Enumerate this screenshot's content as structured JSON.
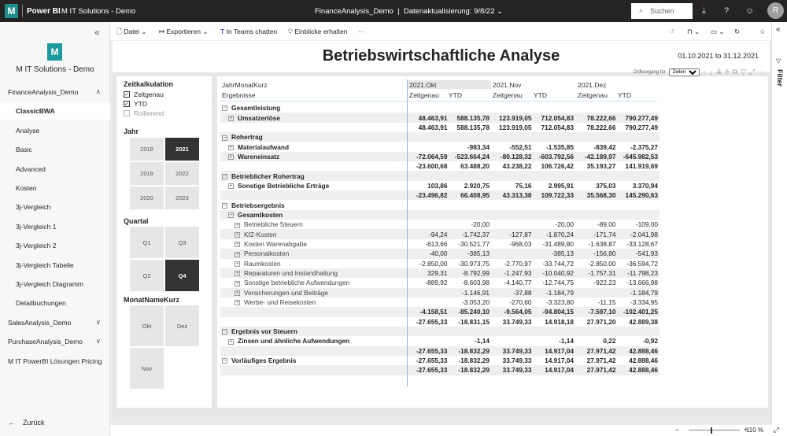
{
  "topbar": {
    "logo": "M",
    "app": "Power BI",
    "workspace": "M IT Solutions - Demo",
    "report": "FinanceAnalysis_Demo",
    "refresh": "Datenaktualisierung: 9/8/22",
    "search_placeholder": "Suchen",
    "avatar_initial": "R"
  },
  "toolbar": {
    "file": "Datei",
    "export": "Exportieren",
    "teams": "In Teams chatten",
    "insights": "Einblicke erhalten",
    "more": "···"
  },
  "sidebar": {
    "logo": "M",
    "workspace": "M IT Solutions - Demo",
    "items": [
      {
        "label": "FinanceAnalysis_Demo",
        "chev": "∧"
      },
      {
        "label": "ClassicBWA",
        "sub": true,
        "selected": true
      },
      {
        "label": "Analyse",
        "sub": true
      },
      {
        "label": "Basic",
        "sub": true
      },
      {
        "label": "Advanced",
        "sub": true
      },
      {
        "label": "Kosten",
        "sub": true
      },
      {
        "label": "3j-Vergleich",
        "sub": true
      },
      {
        "label": "3j-Vergleich 1",
        "sub": true
      },
      {
        "label": "3j-Vergleich 2",
        "sub": true
      },
      {
        "label": "3j-Vergleich Tabelle",
        "sub": true
      },
      {
        "label": "3j-Vergleich Diagramm",
        "sub": true
      },
      {
        "label": "Detailbuchungen",
        "sub": true
      },
      {
        "label": "SalesAnalysis_Demo",
        "chev": "∨"
      },
      {
        "label": "PurchaseAnalysis_Demo",
        "chev": "∨"
      },
      {
        "label": "M IT PowerBI Lösungen Pricing"
      }
    ],
    "back": "Zurück"
  },
  "report": {
    "title": "Betriebswirtschaftliche Analyse",
    "daterange": "01.10.2021 to 31.12.2021",
    "drill_label": "Drillvorgang für",
    "drill_value": "Zeilen"
  },
  "slicers": {
    "zeit": {
      "title": "Zeitkalkulation",
      "options": [
        {
          "label": "Zeitgenau",
          "checked": true
        },
        {
          "label": "YTD",
          "checked": true
        },
        {
          "label": "Rollierend",
          "checked": false
        }
      ]
    },
    "jahr": {
      "title": "Jahr",
      "tiles": [
        {
          "label": "2018"
        },
        {
          "label": "2021",
          "selected": true
        },
        {
          "label": "2019"
        },
        {
          "label": "2022"
        },
        {
          "label": "2020"
        },
        {
          "label": "2023"
        }
      ]
    },
    "quartal": {
      "title": "Quartal",
      "tiles": [
        {
          "label": "Q1"
        },
        {
          "label": "Q3"
        },
        {
          "label": "Q2"
        },
        {
          "label": "Q4",
          "selected": true
        }
      ]
    },
    "monat": {
      "title": "MonatNameKurz",
      "tiles": [
        {
          "label": "Okt"
        },
        {
          "label": "Dez"
        },
        {
          "label": "Nov"
        }
      ]
    }
  },
  "matrix": {
    "row_header1": "JahrMonatKurz",
    "row_header2": "Ergebnisse",
    "months": [
      "2021.Okt",
      "2021.Nov",
      "2021.Dez"
    ],
    "measures": [
      "Zeitgenau",
      "YTD",
      "Zeitgenau",
      "YTD",
      "Zeitgenau",
      "YTD"
    ],
    "rows": [
      {
        "label": "Gesamtleistung",
        "level": 0,
        "bold": true,
        "ex": "−",
        "v": [
          "",
          "",
          "",
          "",
          "",
          ""
        ]
      },
      {
        "label": "Umsatzerlöse",
        "level": 1,
        "bold": true,
        "ex": "+",
        "v": [
          "48.463,91",
          "588.135,78",
          "123.919,05",
          "712.054,83",
          "78.222,66",
          "790.277,49"
        ]
      },
      {
        "label": "",
        "level": 0,
        "bold": true,
        "v": [
          "48.463,91",
          "588.135,78",
          "123.919,05",
          "712.054,83",
          "78.222,66",
          "790.277,49"
        ]
      },
      {
        "label": "Rohertrag",
        "level": 0,
        "bold": true,
        "ex": "−",
        "v": [
          "",
          "",
          "",
          "",
          "",
          ""
        ]
      },
      {
        "label": "Materialaufwand",
        "level": 1,
        "bold": true,
        "ex": "+",
        "v": [
          "",
          "-983,34",
          "-552,51",
          "-1.535,85",
          "-839,42",
          "-2.375,27"
        ]
      },
      {
        "label": "Wareneinsatz",
        "level": 1,
        "bold": true,
        "ex": "+",
        "v": [
          "-72.064,59",
          "-523.664,24",
          "-80.128,32",
          "-603.792,56",
          "-42.189,97",
          "-645.982,53"
        ]
      },
      {
        "label": "",
        "level": 0,
        "bold": true,
        "v": [
          "-23.600,68",
          "63.488,20",
          "43.238,22",
          "106.726,42",
          "35.193,27",
          "141.919,69"
        ]
      },
      {
        "label": "Betrieblicher Rohertrag",
        "level": 0,
        "bold": true,
        "ex": "−",
        "v": [
          "",
          "",
          "",
          "",
          "",
          ""
        ]
      },
      {
        "label": "Sonstige Betriebliche Erträge",
        "level": 1,
        "bold": true,
        "ex": "+",
        "v": [
          "103,86",
          "2.920,75",
          "75,16",
          "2.995,91",
          "375,03",
          "3.370,94"
        ]
      },
      {
        "label": "",
        "level": 0,
        "bold": true,
        "v": [
          "-23.496,82",
          "66.408,95",
          "43.313,38",
          "109.722,33",
          "35.568,30",
          "145.290,63"
        ]
      },
      {
        "label": "Betriebsergebnis",
        "level": 0,
        "bold": true,
        "ex": "−",
        "v": [
          "",
          "",
          "",
          "",
          "",
          ""
        ]
      },
      {
        "label": "Gesamtkosten",
        "level": 1,
        "bold": true,
        "ex": "−",
        "v": [
          "",
          "",
          "",
          "",
          "",
          ""
        ]
      },
      {
        "label": "Betriebliche Steuern",
        "level": 2,
        "ex": "+",
        "v": [
          "",
          "-20,00",
          "",
          "-20,00",
          "-89,00",
          "-109,00"
        ]
      },
      {
        "label": "KfZ-Kosten",
        "level": 2,
        "ex": "+",
        "v": [
          "-94,24",
          "-1.742,37",
          "-127,87",
          "-1.870,24",
          "-171,74",
          "-2.041,98"
        ]
      },
      {
        "label": "Kosten Warenabgabe",
        "level": 2,
        "ex": "+",
        "v": [
          "-613,66",
          "-30.521,77",
          "-968,03",
          "-31.489,80",
          "-1.638,87",
          "-33.128,67"
        ]
      },
      {
        "label": "Personalkosten",
        "level": 2,
        "ex": "+",
        "v": [
          "-40,00",
          "-385,13",
          "",
          "-385,13",
          "-156,80",
          "-541,93"
        ]
      },
      {
        "label": "Raumkosten",
        "level": 2,
        "ex": "+",
        "v": [
          "-2.850,00",
          "-30.973,75",
          "-2.770,97",
          "-33.744,72",
          "-2.850,00",
          "-36.594,72"
        ]
      },
      {
        "label": "Reparaturen und Instandhaltung",
        "level": 2,
        "ex": "+",
        "v": [
          "329,31",
          "-8.792,99",
          "-1.247,93",
          "-10.040,92",
          "-1.757,31",
          "-11.798,23"
        ]
      },
      {
        "label": "Sonstige betriebliche Aufwendungen",
        "level": 2,
        "ex": "+",
        "v": [
          "-889,92",
          "-8.603,98",
          "-4.140,77",
          "-12.744,75",
          "-922,23",
          "-13.666,98"
        ]
      },
      {
        "label": "Versicherungen und Beiträge",
        "level": 2,
        "ex": "+",
        "v": [
          "",
          "-1.146,91",
          "-37,88",
          "-1.184,79",
          "",
          "-1.184,79"
        ]
      },
      {
        "label": "Werbe- und Reisekosten",
        "level": 2,
        "ex": "+",
        "v": [
          "",
          "-3.053,20",
          "-270,60",
          "-3.323,80",
          "-11,15",
          "-3.334,95"
        ]
      },
      {
        "label": "",
        "level": 0,
        "bold": true,
        "v": [
          "-4.158,51",
          "-85.240,10",
          "-9.564,05",
          "-94.804,15",
          "-7.597,10",
          "-102.401,25"
        ]
      },
      {
        "label": "",
        "level": 0,
        "bold": true,
        "v": [
          "-27.655,33",
          "-18.831,15",
          "33.749,33",
          "14.918,18",
          "27.971,20",
          "42.889,38"
        ]
      },
      {
        "label": "Ergebnis vor Steuern",
        "level": 0,
        "bold": true,
        "ex": "−",
        "v": [
          "",
          "",
          "",
          "",
          "",
          ""
        ]
      },
      {
        "label": "Zinsen und ähnliche Aufwendungen",
        "level": 1,
        "bold": true,
        "ex": "+",
        "v": [
          "",
          "-1,14",
          "",
          "-1,14",
          "0,22",
          "-0,92"
        ]
      },
      {
        "label": "",
        "level": 0,
        "bold": true,
        "v": [
          "-27.655,33",
          "-18.832,29",
          "33.749,33",
          "14.917,04",
          "27.971,42",
          "42.888,46"
        ]
      },
      {
        "label": "Vorläufiges Ergebnis",
        "level": 0,
        "bold": true,
        "ex": "−",
        "v": [
          "-27.655,33",
          "-18.832,29",
          "33.749,33",
          "14.917,04",
          "27.971,42",
          "42.888,46"
        ]
      },
      {
        "label": "",
        "level": 0,
        "bold": true,
        "v": [
          "-27.655,33",
          "-18.832,29",
          "33.749,33",
          "14.917,04",
          "27.971,42",
          "42.888,46"
        ]
      }
    ]
  },
  "filter_pane": {
    "label": "Filter"
  },
  "status": {
    "zoom": "110 %"
  }
}
